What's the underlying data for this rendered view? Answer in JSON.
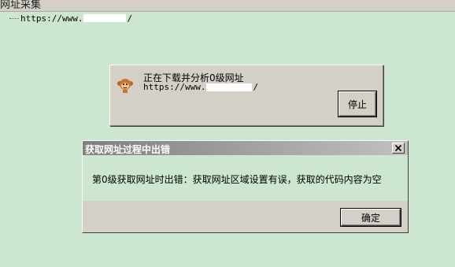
{
  "window": {
    "title": "网址采集"
  },
  "tree": {
    "url_prefix": "https://www.",
    "url_suffix": "/"
  },
  "progress": {
    "title": "正在下载并分析0级网址",
    "url_prefix": "https://www.",
    "url_suffix": "/",
    "stop_label": "停止",
    "icon": "monkey-icon"
  },
  "error_dialog": {
    "title": "获取网址过程中出错",
    "message": "第0级获取网址时出错：获取网址区域设置有误，获取的代码内容为空",
    "ok_label": "确定",
    "close_icon": "close-icon"
  },
  "colors": {
    "background": "#cce6cf",
    "dialog": "#d4d0c8"
  }
}
